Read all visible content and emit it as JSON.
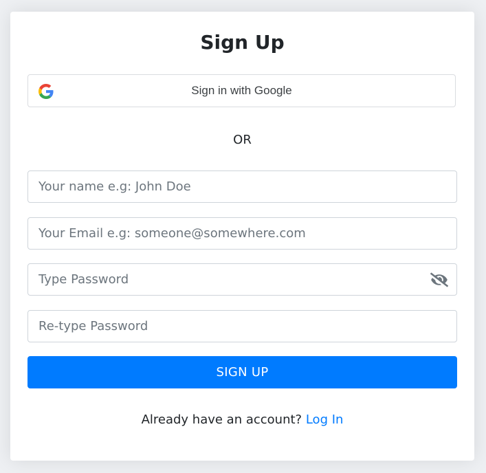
{
  "form": {
    "title": "Sign Up",
    "google_button_label": "Sign in with Google",
    "separator": "OR",
    "name_placeholder": "Your name e.g: John Doe",
    "email_placeholder": "Your Email e.g: someone@somewhere.com",
    "password_placeholder": "Type Password",
    "retype_password_placeholder": "Re-type Password",
    "submit_label": "SIGN UP",
    "footer_text": "Already have an account?",
    "login_link_label": "Log In"
  },
  "icons": {
    "google": "google-logo-icon",
    "password_toggle": "eye-slash-icon"
  },
  "colors": {
    "primary": "#007bff",
    "background": "#eef0f3",
    "card": "#ffffff",
    "text": "#212529",
    "placeholder": "#6c757d",
    "border": "#ced4da"
  }
}
